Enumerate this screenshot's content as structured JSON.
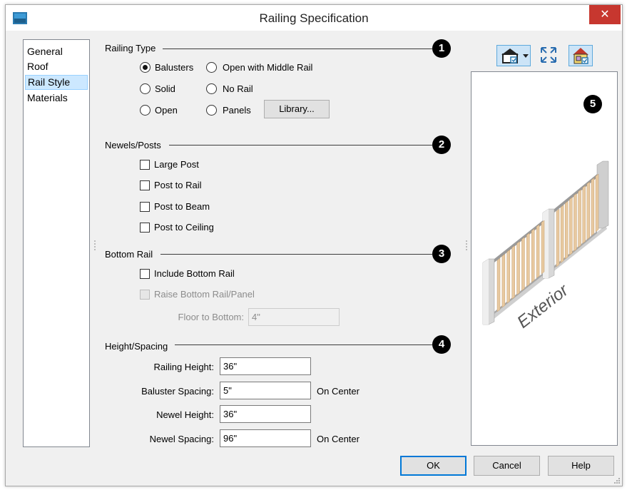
{
  "window": {
    "title": "Railing Specification",
    "close_symbol": "✕",
    "close_color": "#c7372f"
  },
  "sidebar": {
    "items": [
      {
        "label": "General"
      },
      {
        "label": "Roof"
      },
      {
        "label": "Rail Style",
        "selected": true
      },
      {
        "label": "Materials"
      }
    ]
  },
  "callouts": [
    "1",
    "2",
    "3",
    "4",
    "5"
  ],
  "railing_type": {
    "title": "Railing Type",
    "selected": "Balusters",
    "options": [
      "Balusters",
      "Open with Middle Rail",
      "Solid",
      "No Rail",
      "Open",
      "Panels"
    ],
    "library_button": "Library..."
  },
  "newels_posts": {
    "title": "Newels/Posts",
    "options": [
      {
        "label": "Large Post",
        "checked": false
      },
      {
        "label": "Post to Rail",
        "checked": false
      },
      {
        "label": "Post to Beam",
        "checked": false
      },
      {
        "label": "Post to Ceiling",
        "checked": false
      }
    ]
  },
  "bottom_rail": {
    "title": "Bottom Rail",
    "include_label": "Include Bottom Rail",
    "raise_label": "Raise Bottom Rail/Panel",
    "floor_to_bottom_label": "Floor to Bottom:",
    "floor_to_bottom_value": "4\""
  },
  "height_spacing": {
    "title": "Height/Spacing",
    "railing_height_label": "Railing Height:",
    "railing_height_value": "36\"",
    "baluster_spacing_label": "Baluster Spacing:",
    "baluster_spacing_value": "5\"",
    "newel_height_label": "Newel Height:",
    "newel_height_value": "36\"",
    "newel_spacing_label": "Newel Spacing:",
    "newel_spacing_value": "96\"",
    "on_center": "On Center"
  },
  "preview": {
    "label": "Exterior"
  },
  "footer": {
    "ok": "OK",
    "cancel": "Cancel",
    "help": "Help"
  }
}
